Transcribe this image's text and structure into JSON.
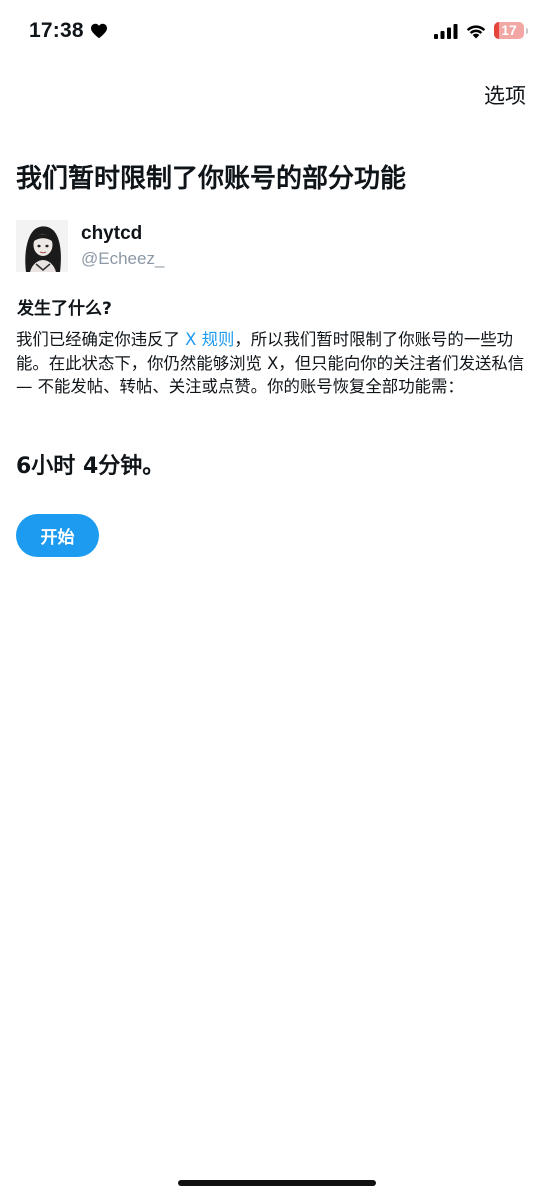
{
  "status_bar": {
    "time": "17:38",
    "time_icon": "heart-icon",
    "signal_icon": "cellular-signal-icon",
    "wifi_icon": "wifi-icon",
    "battery_level": "17",
    "battery_fraction": 0.17,
    "battery_color": "#e5443a"
  },
  "header": {
    "options_label": "选项"
  },
  "title": "我们暂时限制了你账号的部分功能",
  "user": {
    "display_name": "chytcd",
    "handle": "@Echeez_"
  },
  "section": {
    "heading": "发生了什么?",
    "body_before_link": "我们已经确定你违反了 ",
    "rules_link": "X 规则",
    "body_after_link": "，所以我们暂时限制了你账号的一些功能。在此状态下，你仍然能够浏览 X，但只能向你的关注者们发送私信 — 不能发帖、转帖、关注或点赞。你的账号恢复全部功能需："
  },
  "countdown": "6小时 4分钟。",
  "start_button_label": "开始",
  "colors": {
    "accent": "#1d9bf0",
    "text": "#0f1419",
    "secondary_text": "#8b98a5"
  }
}
